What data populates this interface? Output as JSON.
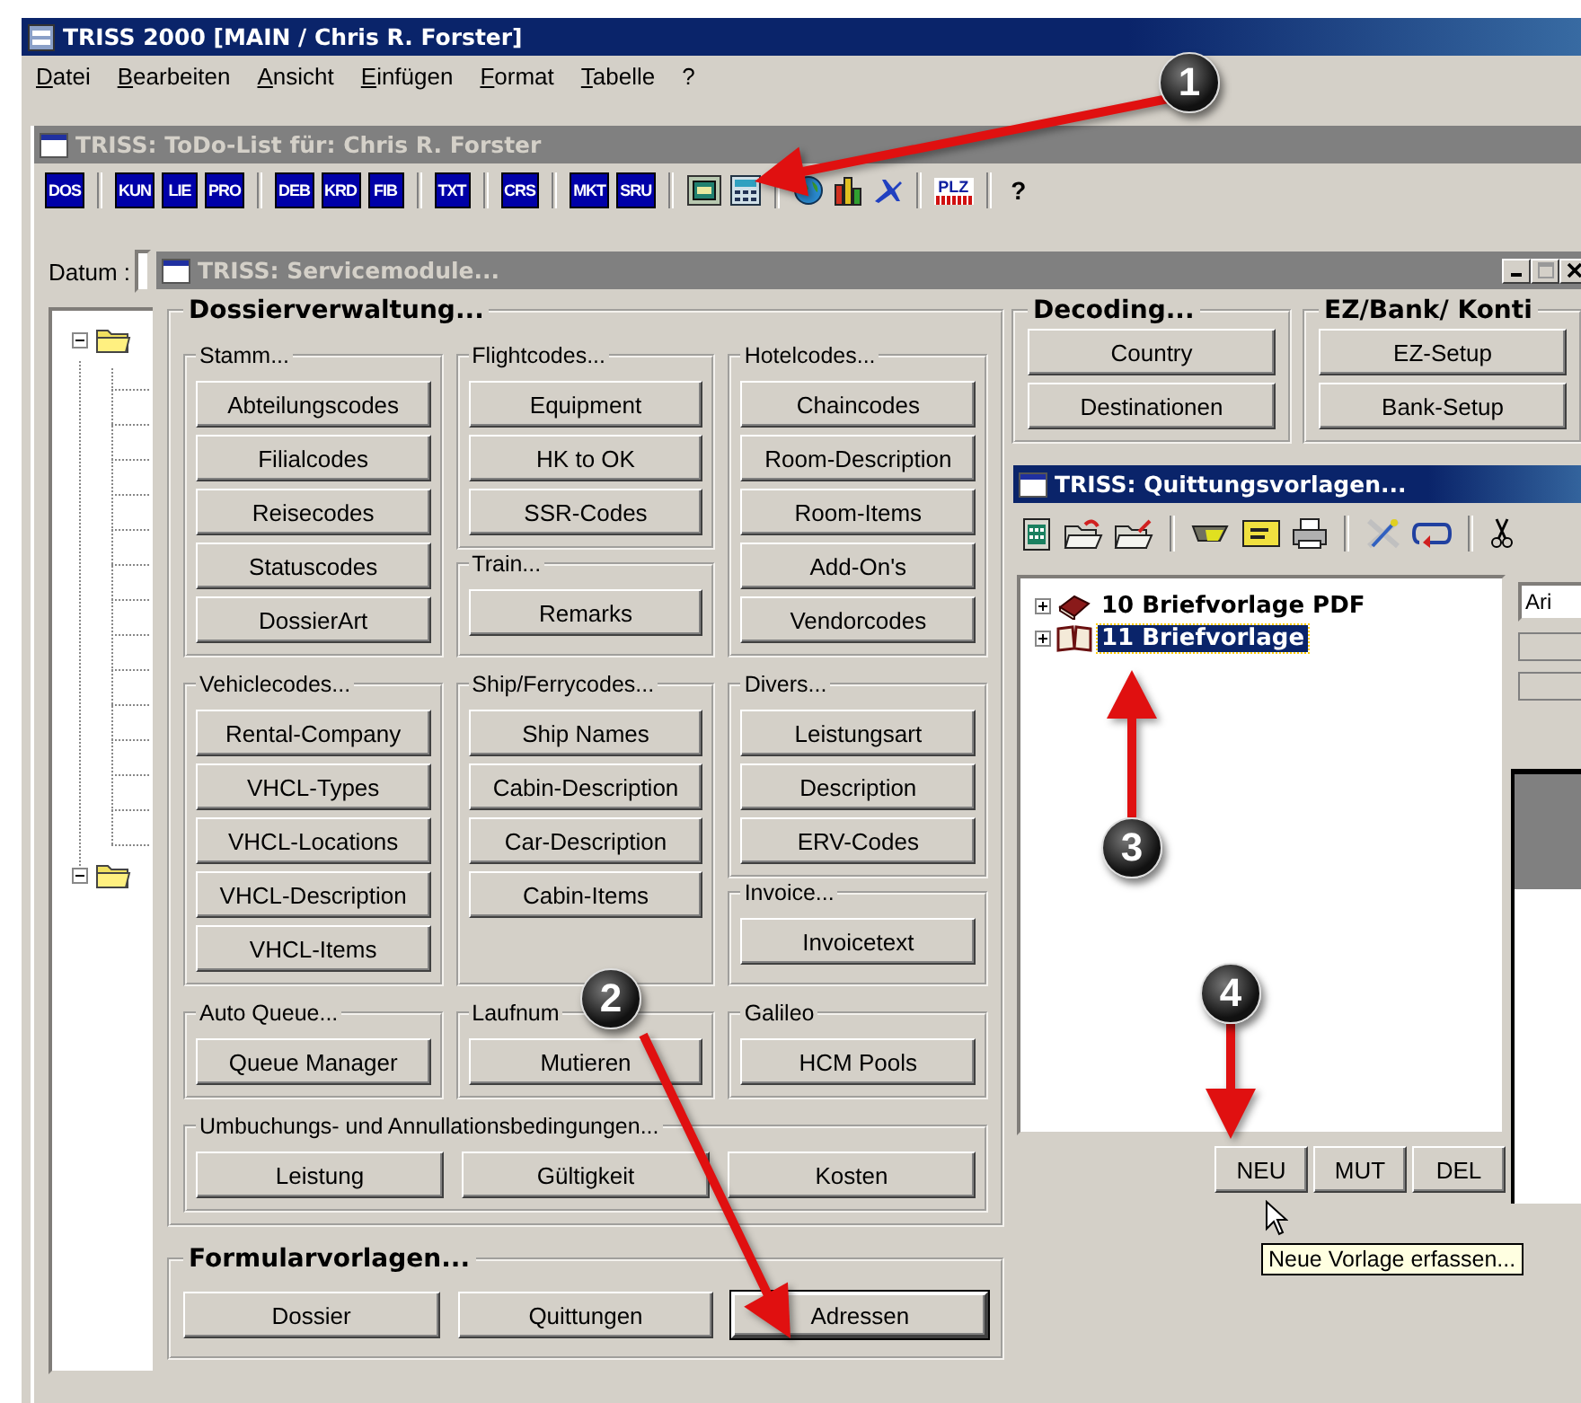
{
  "main_window": {
    "title": "TRISS 2000 [MAIN / Chris R. Forster]",
    "menu": [
      "Datei",
      "Bearbeiten",
      "Ansicht",
      "Einfügen",
      "Format",
      "Tabelle",
      "?"
    ]
  },
  "todo_window": {
    "title": "TRISS: ToDo-List für: Chris R. Forster",
    "toolbar": {
      "groups": [
        [
          "DOS"
        ],
        [
          "KUN",
          "LIE",
          "PRO"
        ],
        [
          "DEB",
          "KRD",
          "FIB"
        ],
        [
          "TXT"
        ],
        [
          "CRS"
        ],
        [
          "MKT",
          "SRU"
        ]
      ],
      "plz": "PLZ",
      "help": "?"
    },
    "date_label": "Datum :"
  },
  "service_window": {
    "title": "TRISS: Servicemodule...",
    "dossier": {
      "title": "Dossierverwaltung...",
      "rows": [
        [
          [
            {
              "title": "Stamm...",
              "buttons": [
                "Abteilungscodes",
                "Filialcodes",
                "Reisecodes",
                "Statuscodes",
                "DossierArt"
              ]
            }
          ],
          [
            {
              "title": "Flightcodes...",
              "buttons": [
                "Equipment",
                "HK to OK",
                "SSR-Codes"
              ]
            },
            {
              "title": "Train...",
              "buttons": [
                "Remarks"
              ]
            }
          ],
          [
            {
              "title": "Hotelcodes...",
              "buttons": [
                "Chaincodes",
                "Room-Description",
                "Room-Items",
                "Add-On's",
                "Vendorcodes"
              ]
            }
          ]
        ],
        [
          [
            {
              "title": "Vehiclecodes...",
              "buttons": [
                "Rental-Company",
                "VHCL-Types",
                "VHCL-Locations",
                "VHCL-Description",
                "VHCL-Items"
              ]
            }
          ],
          [
            {
              "title": "Ship/Ferrycodes...",
              "buttons": [
                "Ship Names",
                "Cabin-Description",
                "Car-Description",
                "Cabin-Items"
              ]
            }
          ],
          [
            {
              "title": "Divers...",
              "buttons": [
                "Leistungsart",
                "Description",
                "ERV-Codes"
              ]
            },
            {
              "title": "Invoice...",
              "buttons": [
                "Invoicetext"
              ]
            }
          ]
        ],
        [
          [
            {
              "title": "Auto Queue...",
              "buttons": [
                "Queue Manager"
              ]
            }
          ],
          [
            {
              "title": "Laufnum",
              "buttons": [
                "Mutieren"
              ]
            }
          ],
          [
            {
              "title": "Galileo",
              "buttons": [
                "HCM Pools"
              ]
            }
          ]
        ],
        [
          [
            {
              "title": "Umbuchungs- und Annullationsbedingungen...",
              "buttons": [
                "Leistung",
                "Gültigkeit",
                "Kosten"
              ]
            }
          ]
        ]
      ]
    },
    "formular": {
      "title": "Formularvorlagen...",
      "buttons": [
        {
          "label": "Dossier",
          "focused": false
        },
        {
          "label": "Quittungen",
          "focused": false
        },
        {
          "label": "Adressen",
          "focused": true
        }
      ]
    },
    "decoding": {
      "title": "Decoding...",
      "buttons": [
        "Country",
        "Destinationen"
      ]
    },
    "ez_bank": {
      "title": "EZ/Bank/ Konti",
      "buttons": [
        "EZ-Setup",
        "Bank-Setup"
      ]
    }
  },
  "quittung_window": {
    "title": "TRISS: Quittungsvorlagen...",
    "tree": [
      {
        "label": "10 Briefvorlage PDF",
        "kind": "closed",
        "selected": false
      },
      {
        "label": "11 Briefvorlage",
        "kind": "open",
        "selected": true
      }
    ],
    "font_field": "Ari",
    "buttons": [
      "NEU",
      "MUT",
      "DEL"
    ],
    "tooltip": "Neue Vorlage erfassen..."
  },
  "callouts": [
    "1",
    "2",
    "3",
    "4"
  ]
}
